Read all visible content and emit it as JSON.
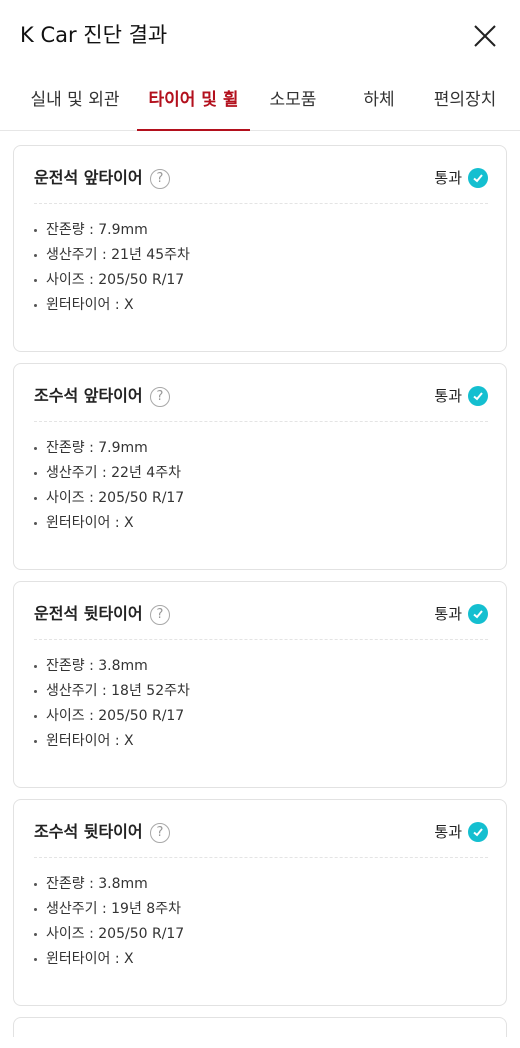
{
  "header": {
    "title": "K Car 진단 결과"
  },
  "tabs": [
    {
      "label": "실내 및 외관"
    },
    {
      "label": "타이어 및 휠"
    },
    {
      "label": "소모품"
    },
    {
      "label": "하체"
    },
    {
      "label": "편의장치"
    }
  ],
  "active_tab": "타이어 및 휠",
  "tires": [
    {
      "title": "운전석 앞타이어",
      "status": "통과",
      "specs": [
        "잔존량 : 7.9mm",
        "생산주기 : 21년 45주차",
        "사이즈 : 205/50 R/17",
        "윈터타이어 : X"
      ]
    },
    {
      "title": "조수석 앞타이어",
      "status": "통과",
      "specs": [
        "잔존량 : 7.9mm",
        "생산주기 : 22년 4주차",
        "사이즈 : 205/50 R/17",
        "윈터타이어 : X"
      ]
    },
    {
      "title": "운전석 뒷타이어",
      "status": "통과",
      "specs": [
        "잔존량 : 3.8mm",
        "생산주기 : 18년 52주차",
        "사이즈 : 205/50 R/17",
        "윈터타이어 : X"
      ]
    },
    {
      "title": "조수석 뒷타이어",
      "status": "통과",
      "specs": [
        "잔존량 : 3.8mm",
        "생산주기 : 19년 8주차",
        "사이즈 : 205/50 R/17",
        "윈터타이어 : X"
      ]
    }
  ],
  "icons": {
    "help": "?"
  },
  "colors": {
    "accent": "#b3101d",
    "pass": "#14bfd0"
  }
}
